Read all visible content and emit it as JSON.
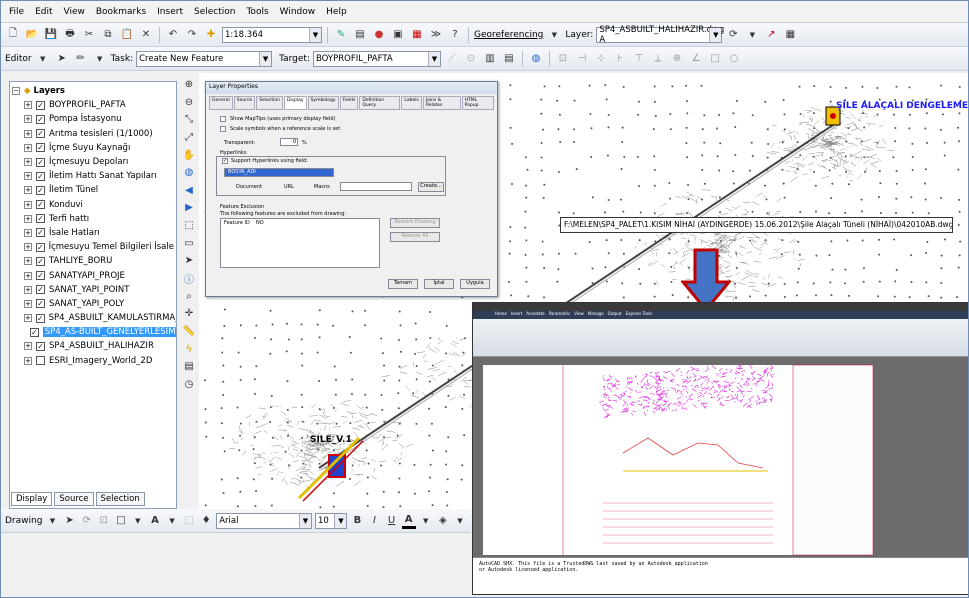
{
  "menu": {
    "items": [
      "File",
      "Edit",
      "View",
      "Bookmarks",
      "Insert",
      "Selection",
      "Tools",
      "Window",
      "Help"
    ]
  },
  "toolbar1": {
    "scale_value": "1:18.364",
    "georef_label": "Georeferencing",
    "layer_label": "Layer:",
    "layer_value": "SP4_ASBUILT_HALIHAZIR.dwg A"
  },
  "toolbar2": {
    "editor_label": "Editor",
    "task_label": "Task:",
    "task_value": "Create New Feature",
    "target_label": "Target:",
    "target_value": "BOYPROFIL_PAFTA"
  },
  "toc": {
    "root_label": "Layers",
    "layers": [
      {
        "label": "BOYPROFIL_PAFTA",
        "checked": true,
        "selected": false
      },
      {
        "label": "Pompa İstasyonu",
        "checked": true,
        "selected": false
      },
      {
        "label": "Arıtma tesisleri (1/1000)",
        "checked": true,
        "selected": false
      },
      {
        "label": "İçme Suyu Kaynağı",
        "checked": true,
        "selected": false
      },
      {
        "label": "İçmesuyu Depoları",
        "checked": true,
        "selected": false
      },
      {
        "label": "İletim Hattı Sanat Yapıları",
        "checked": true,
        "selected": false
      },
      {
        "label": "İletim Tünel",
        "checked": true,
        "selected": false
      },
      {
        "label": "Konduvi",
        "checked": true,
        "selected": false
      },
      {
        "label": "Terfi hattı",
        "checked": true,
        "selected": false
      },
      {
        "label": "İsale Hatları",
        "checked": true,
        "selected": false
      },
      {
        "label": "İçmesuyu Temel Bilgileri İsale h",
        "checked": true,
        "selected": false
      },
      {
        "label": "TAHLIYE_BORU",
        "checked": true,
        "selected": false
      },
      {
        "label": "SANATYAPI_PROJE",
        "checked": true,
        "selected": false
      },
      {
        "label": "SANAT_YAPI_POINT",
        "checked": true,
        "selected": false
      },
      {
        "label": "SANAT_YAPI_POLY",
        "checked": true,
        "selected": false
      },
      {
        "label": "SP4_ASBUILT_KAMULASTIRMA_",
        "checked": true,
        "selected": false
      },
      {
        "label": "SP4_AS-BUILT_GENELYERLESIMI",
        "checked": true,
        "selected": true
      },
      {
        "label": "SP4_ASBUILT_HALIHAZIR",
        "checked": true,
        "selected": false
      },
      {
        "label": "ESRI_Imagery_World_2D",
        "checked": false,
        "selected": false
      }
    ],
    "tabs": [
      "Display",
      "Source",
      "Selection"
    ]
  },
  "dialog": {
    "title": "Layer Properties",
    "tabs": [
      "General",
      "Source",
      "Selection",
      "Display",
      "Symbology",
      "Fields",
      "Definition Query",
      "Labels",
      "Joins & Relates",
      "HTML Popup"
    ],
    "active_tab": "Display",
    "opt_maptips": "Show MapTips (uses primary display field)",
    "opt_scale": "Scale symbols when a reference scale is set",
    "transparent_label": "Transparent:",
    "transparent_value": "0",
    "transparent_unit": "%",
    "hyperlinks_label": "Hyperlinks",
    "support_hyperlinks": "Support Hyperlinks using field:",
    "field_value": "BOSYA_ADI",
    "radio_document": "Document",
    "radio_url": "URL",
    "radio_macro": "Macro:",
    "create_btn": "Create...",
    "feature_exclusion": "Feature Exclusion",
    "exclusion_text": "The following features are excluded from drawing:",
    "col_feature_id": "Feature ID",
    "col_no": "NO",
    "restore_drawing": "Restore Drawing",
    "restore_all": "Restore All",
    "ok_btn": "Tamam",
    "cancel_btn": "İptal",
    "apply_btn": "Uygula"
  },
  "map": {
    "label_top": "ŞİLE ALAÇALI DENGELEME D",
    "label_bottom": "SILE_V.1",
    "hyperlink_tip": "F:\\MELEN\\SP4_PALET\\1.KISIM NİHAİ (AYDINGERDE) 15.06.2012\\Şile Alaçalı Tüneli (NİHAİ)\\042010AB.dwg"
  },
  "autocad": {
    "ribbon_tabs": [
      "Home",
      "Insert",
      "Annotate",
      "Parametric",
      "View",
      "Manage",
      "Output",
      "Express Tools"
    ],
    "cmd_line1": "AutoCAD SHX. This file is a TrustedDWG last saved by an Autodesk application",
    "cmd_line2": "or Autodesk licensed application."
  },
  "drawbar": {
    "drawing_label": "Drawing",
    "font_value": "Arial",
    "size_value": "10"
  },
  "colors": {
    "selection": "#3399ff",
    "arrow_fill": "#4472c4",
    "arrow_stroke": "#c00000",
    "magenta": "#e020e0"
  }
}
